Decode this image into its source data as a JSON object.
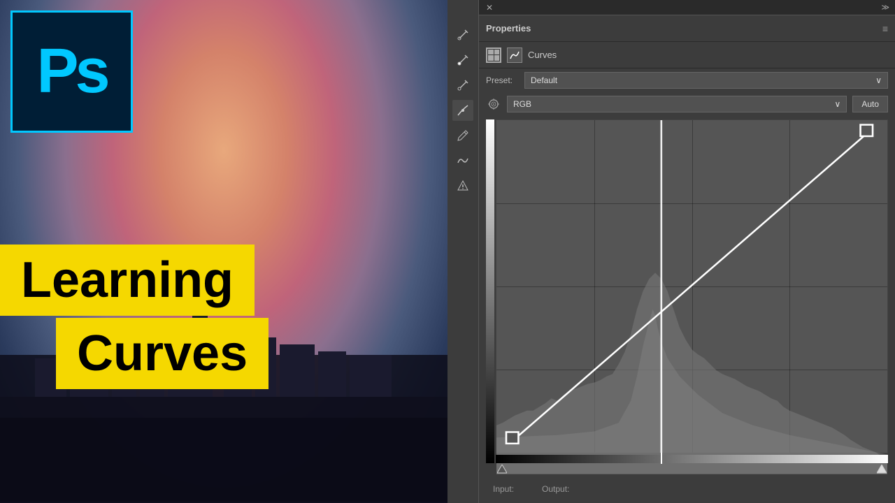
{
  "left": {
    "ps_logo": "Ps",
    "learning_text": "Learning",
    "curves_text": "Curves"
  },
  "top_bar": {
    "close": "✕",
    "expand": "≫"
  },
  "properties": {
    "title": "Properties",
    "curves_label": "Curves",
    "preset_label": "Preset:",
    "preset_value": "Default",
    "preset_chevron": "∨",
    "channel_value": "RGB",
    "channel_chevron": "∨",
    "auto_label": "Auto",
    "input_label": "Input:",
    "output_label": "Output:"
  },
  "tools": {
    "eyedropper_auto": "⚡",
    "eyedropper_white": "⚡",
    "eyedropper_black": "⚡",
    "curve_tool": "~",
    "pencil": "✎",
    "smooth": "≈",
    "warning": "⚠"
  }
}
